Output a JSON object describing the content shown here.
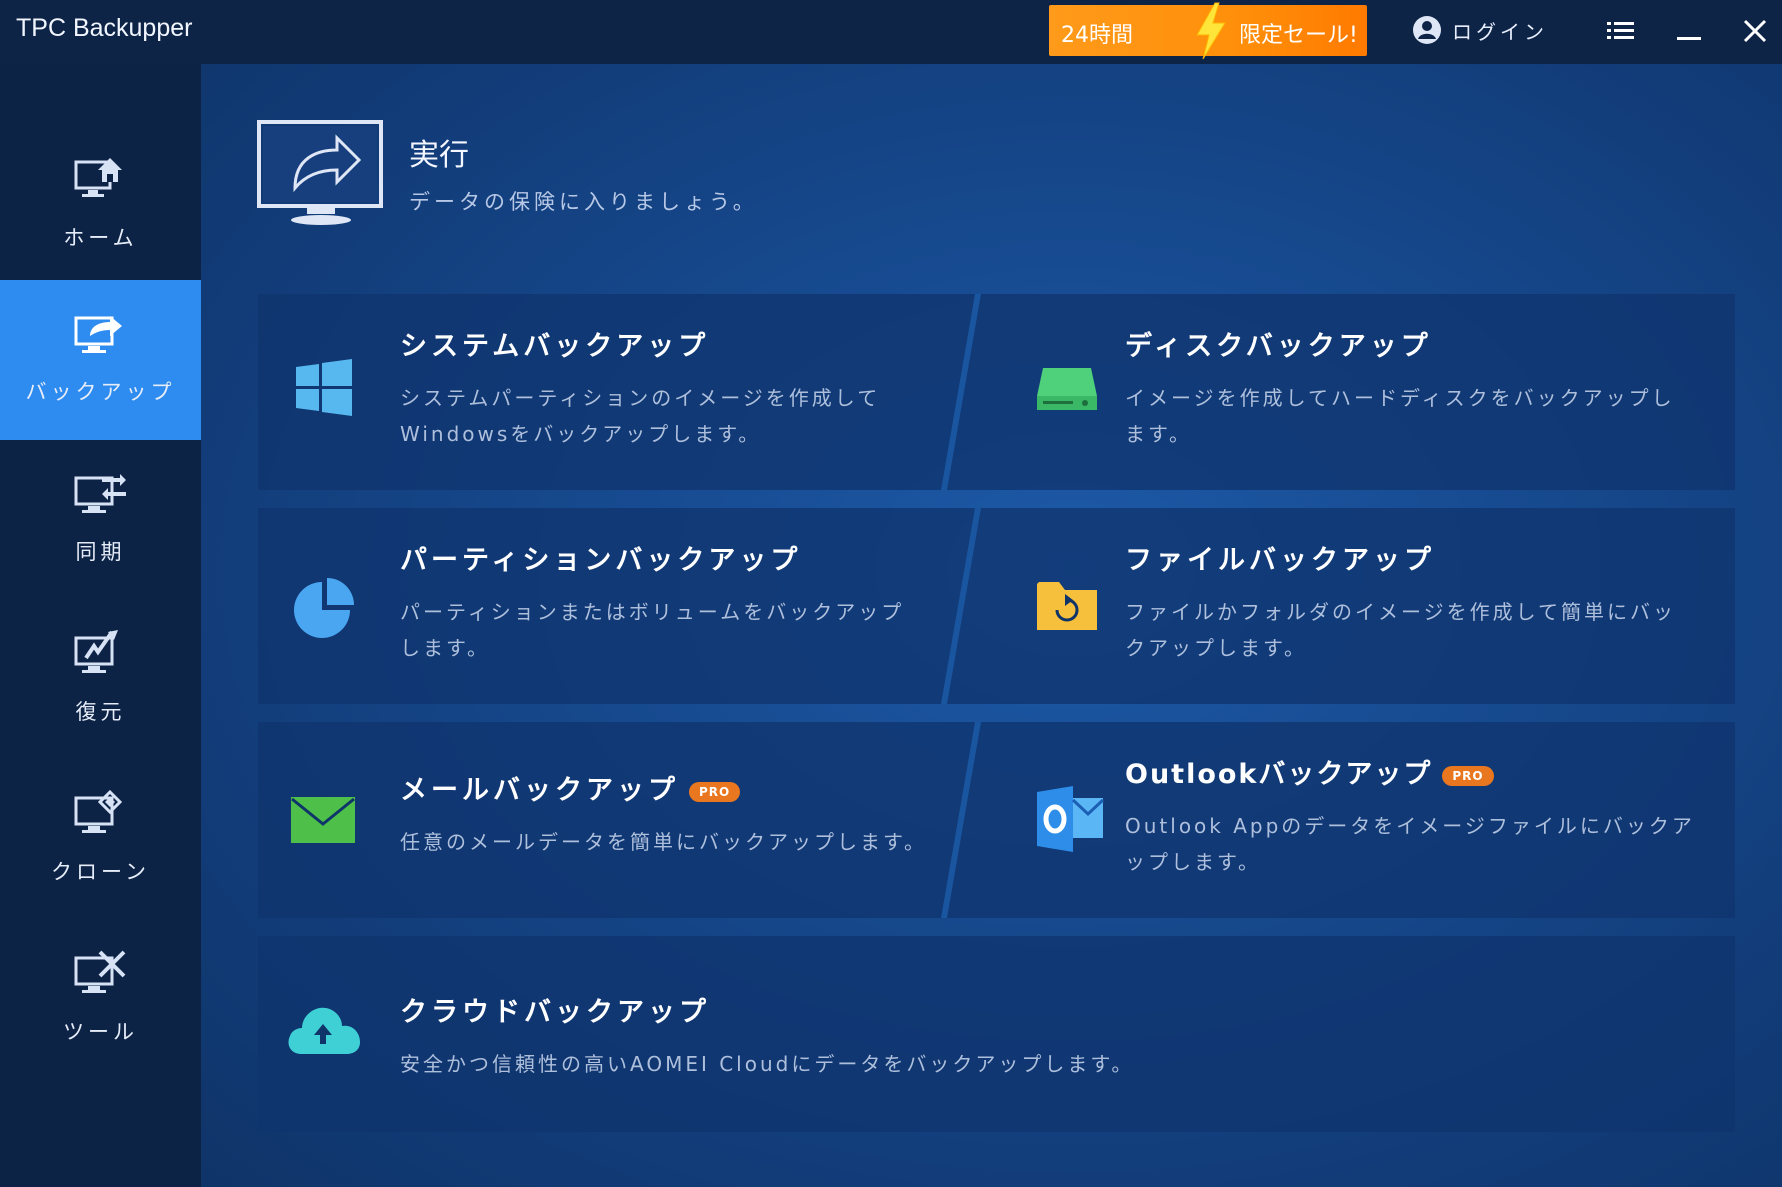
{
  "app": {
    "title": "TPC Backupper"
  },
  "promo": {
    "left_text": "24時間",
    "right_text": "限定セール!"
  },
  "login": {
    "label": "ログイン"
  },
  "window_controls": {
    "menu": "menu-icon",
    "minimize": "minimize-icon",
    "close": "close-icon"
  },
  "sidebar": {
    "items": [
      {
        "label": "ホーム",
        "icon": "home-monitor-icon"
      },
      {
        "label": "バックアップ",
        "icon": "backup-monitor-icon",
        "active": true
      },
      {
        "label": "同期",
        "icon": "sync-monitor-icon"
      },
      {
        "label": "復元",
        "icon": "restore-monitor-icon"
      },
      {
        "label": "クローン",
        "icon": "clone-monitor-icon"
      },
      {
        "label": "ツール",
        "icon": "tools-monitor-icon"
      }
    ]
  },
  "hero": {
    "title": "実行",
    "subtitle": "データの保険に入りましょう。"
  },
  "cards": [
    {
      "title": "システムバックアップ",
      "desc": "システムパーティションのイメージを作成してWindowsをバックアップします。",
      "icon": "windows-icon",
      "pro": false
    },
    {
      "title": "ディスクバックアップ",
      "desc": "イメージを作成してハードディスクをバックアップします。",
      "icon": "disk-icon",
      "pro": false
    },
    {
      "title": "パーティションバックアップ",
      "desc": "パーティションまたはボリュームをバックアップします。",
      "icon": "partition-pie-icon",
      "pro": false
    },
    {
      "title": "ファイルバックアップ",
      "desc": "ファイルかフォルダのイメージを作成して簡単にバックアップします。",
      "icon": "folder-sync-icon",
      "pro": false
    },
    {
      "title": "メールバックアップ",
      "desc": "任意のメールデータを簡単にバックアップします。",
      "icon": "mail-icon",
      "pro": true,
      "pro_label": "PRO"
    },
    {
      "title": "Outlookバックアップ",
      "desc": "Outlook Appのデータをイメージファイルにバックアップします。",
      "icon": "outlook-icon",
      "pro": true,
      "pro_label": "PRO"
    },
    {
      "title": "クラウドバックアップ",
      "desc": "安全かつ信頼性の高いAOMEI Cloudにデータをバックアップします。",
      "icon": "cloud-upload-icon",
      "pro": false
    }
  ],
  "colors": {
    "accent": "#2e8cf0",
    "promo": "#ff8f0a",
    "pro_badge": "#e8771f"
  }
}
